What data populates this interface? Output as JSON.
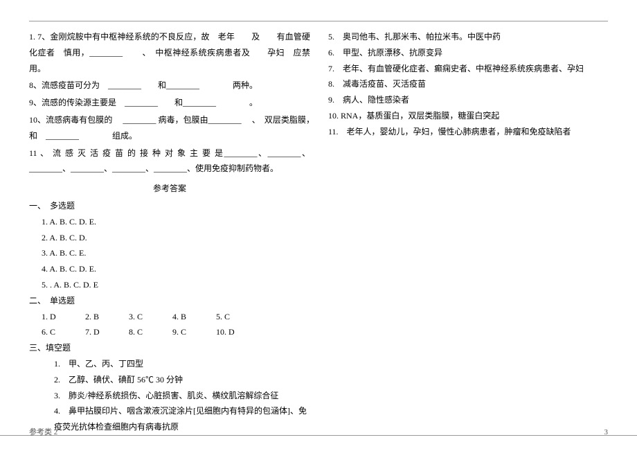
{
  "left": {
    "q7": "1.  7、金刚烷胺中有中枢神经系统的不良反应，故　老年　　及　　有血管硬化症者　慎用，________ 　　、　中枢神经系统疾病患者及　　孕妇　应禁用。",
    "q8": "8、流感疫苗可分为　________　　和________　　　　两种。",
    "q9": "9、流感的传染源主要是　________　　和________　　　　。",
    "q10": "10、流感病毒有包膜的 　________ 病毒，包膜由________ 　、　双层类脂膜，　和　________　　　　组成。",
    "q11": "11 、 流 感 灭 活 疫 苗 的 接 种 对 象 主 要 是________、________、________、________、________、________、使用免疫抑制药物者。",
    "ans_title": "参考答案",
    "sec1": "一、　多选题",
    "a1": "1. A. B. C. D. E.",
    "a2": "2. A. B. C. D.",
    "a3": "3. A. B. C. E.",
    "a4": "4. A. B. C. D. E.",
    "a5": "5. . A. B. C. D. E",
    "sec2": "二、　单选题",
    "row1": {
      "c1": "1. D",
      "c2": "2. B",
      "c3": "3. C",
      "c4": "4. B",
      "c5": "5. C"
    },
    "row2": {
      "c1": "6. C",
      "c2": "7. D",
      "c3": "8. C",
      "c4": "9. C",
      "c5": "10. D"
    },
    "sec3": "三、填空题",
    "f1": "1.　甲、乙、丙、丁四型",
    "f2": "2.　乙醇、碘伏、碘酊 56℃ 30 分钟",
    "f3": "3.　肺炎/神经系统损伤、心脏损害、肌炎、横纹肌溶解综合征",
    "f4": "4.　鼻甲拈膜印片、咽含漱液沉淀涂片[见细胞内有特异的包涵体]、免疫荧光抗体检查细胞内有病毒抗原"
  },
  "right": {
    "r5": "5.　奥司他韦、扎那米韦、帕拉米韦。中医中药",
    "r6": "6.　甲型、抗原漂移、抗原变异",
    "r7": "7.　老年、有血管硬化症者、癫痫史者、中枢神经系统疾病患者、孕妇",
    "r8": "8.　减毒活疫苗、灭活疫苗",
    "r9": "9.　病人、隐性感染者",
    "r10": "10. RNA，基质蛋白，双层类脂膜，糖蛋白突起",
    "r11": "11.　老年人，婴幼儿，孕妇，慢性心肺病患者，肿瘤和免疫缺陷者"
  },
  "footer": {
    "left": "参考类 2",
    "right": "3"
  }
}
